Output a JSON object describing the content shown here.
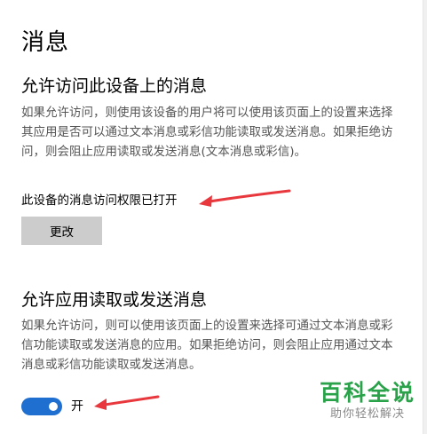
{
  "page": {
    "title": "消息"
  },
  "device_access": {
    "heading": "允许访问此设备上的消息",
    "description": "如果允许访问，则使用该设备的用户将可以使用该页面上的设置来选择其应用是否可以通过文本消息或彩信功能读取或发送消息。如果拒绝访问，则会阻止应用读取或发送消息(文本消息或彩信)。",
    "status": "此设备的消息访问权限已打开",
    "change_button": "更改"
  },
  "app_access": {
    "heading": "允许应用读取或发送消息",
    "description": "如果允许访问，则可以使用该页面上的设置来选择可通过文本消息或彩信功能读取或发送消息的应用。如果拒绝访问，则会阻止应用通过文本消息或彩信功能读取或发送消息。",
    "toggle_state": "on",
    "toggle_label": "开"
  },
  "watermark": {
    "main": "百科全说",
    "sub": "助你轻松解决"
  },
  "colors": {
    "toggle_on": "#1f6fd1",
    "button_bg": "#cccccc",
    "arrow": "#e8383d",
    "watermark_green": "#2aa24a"
  },
  "icons": {
    "annotation": "red-arrow-icon"
  }
}
